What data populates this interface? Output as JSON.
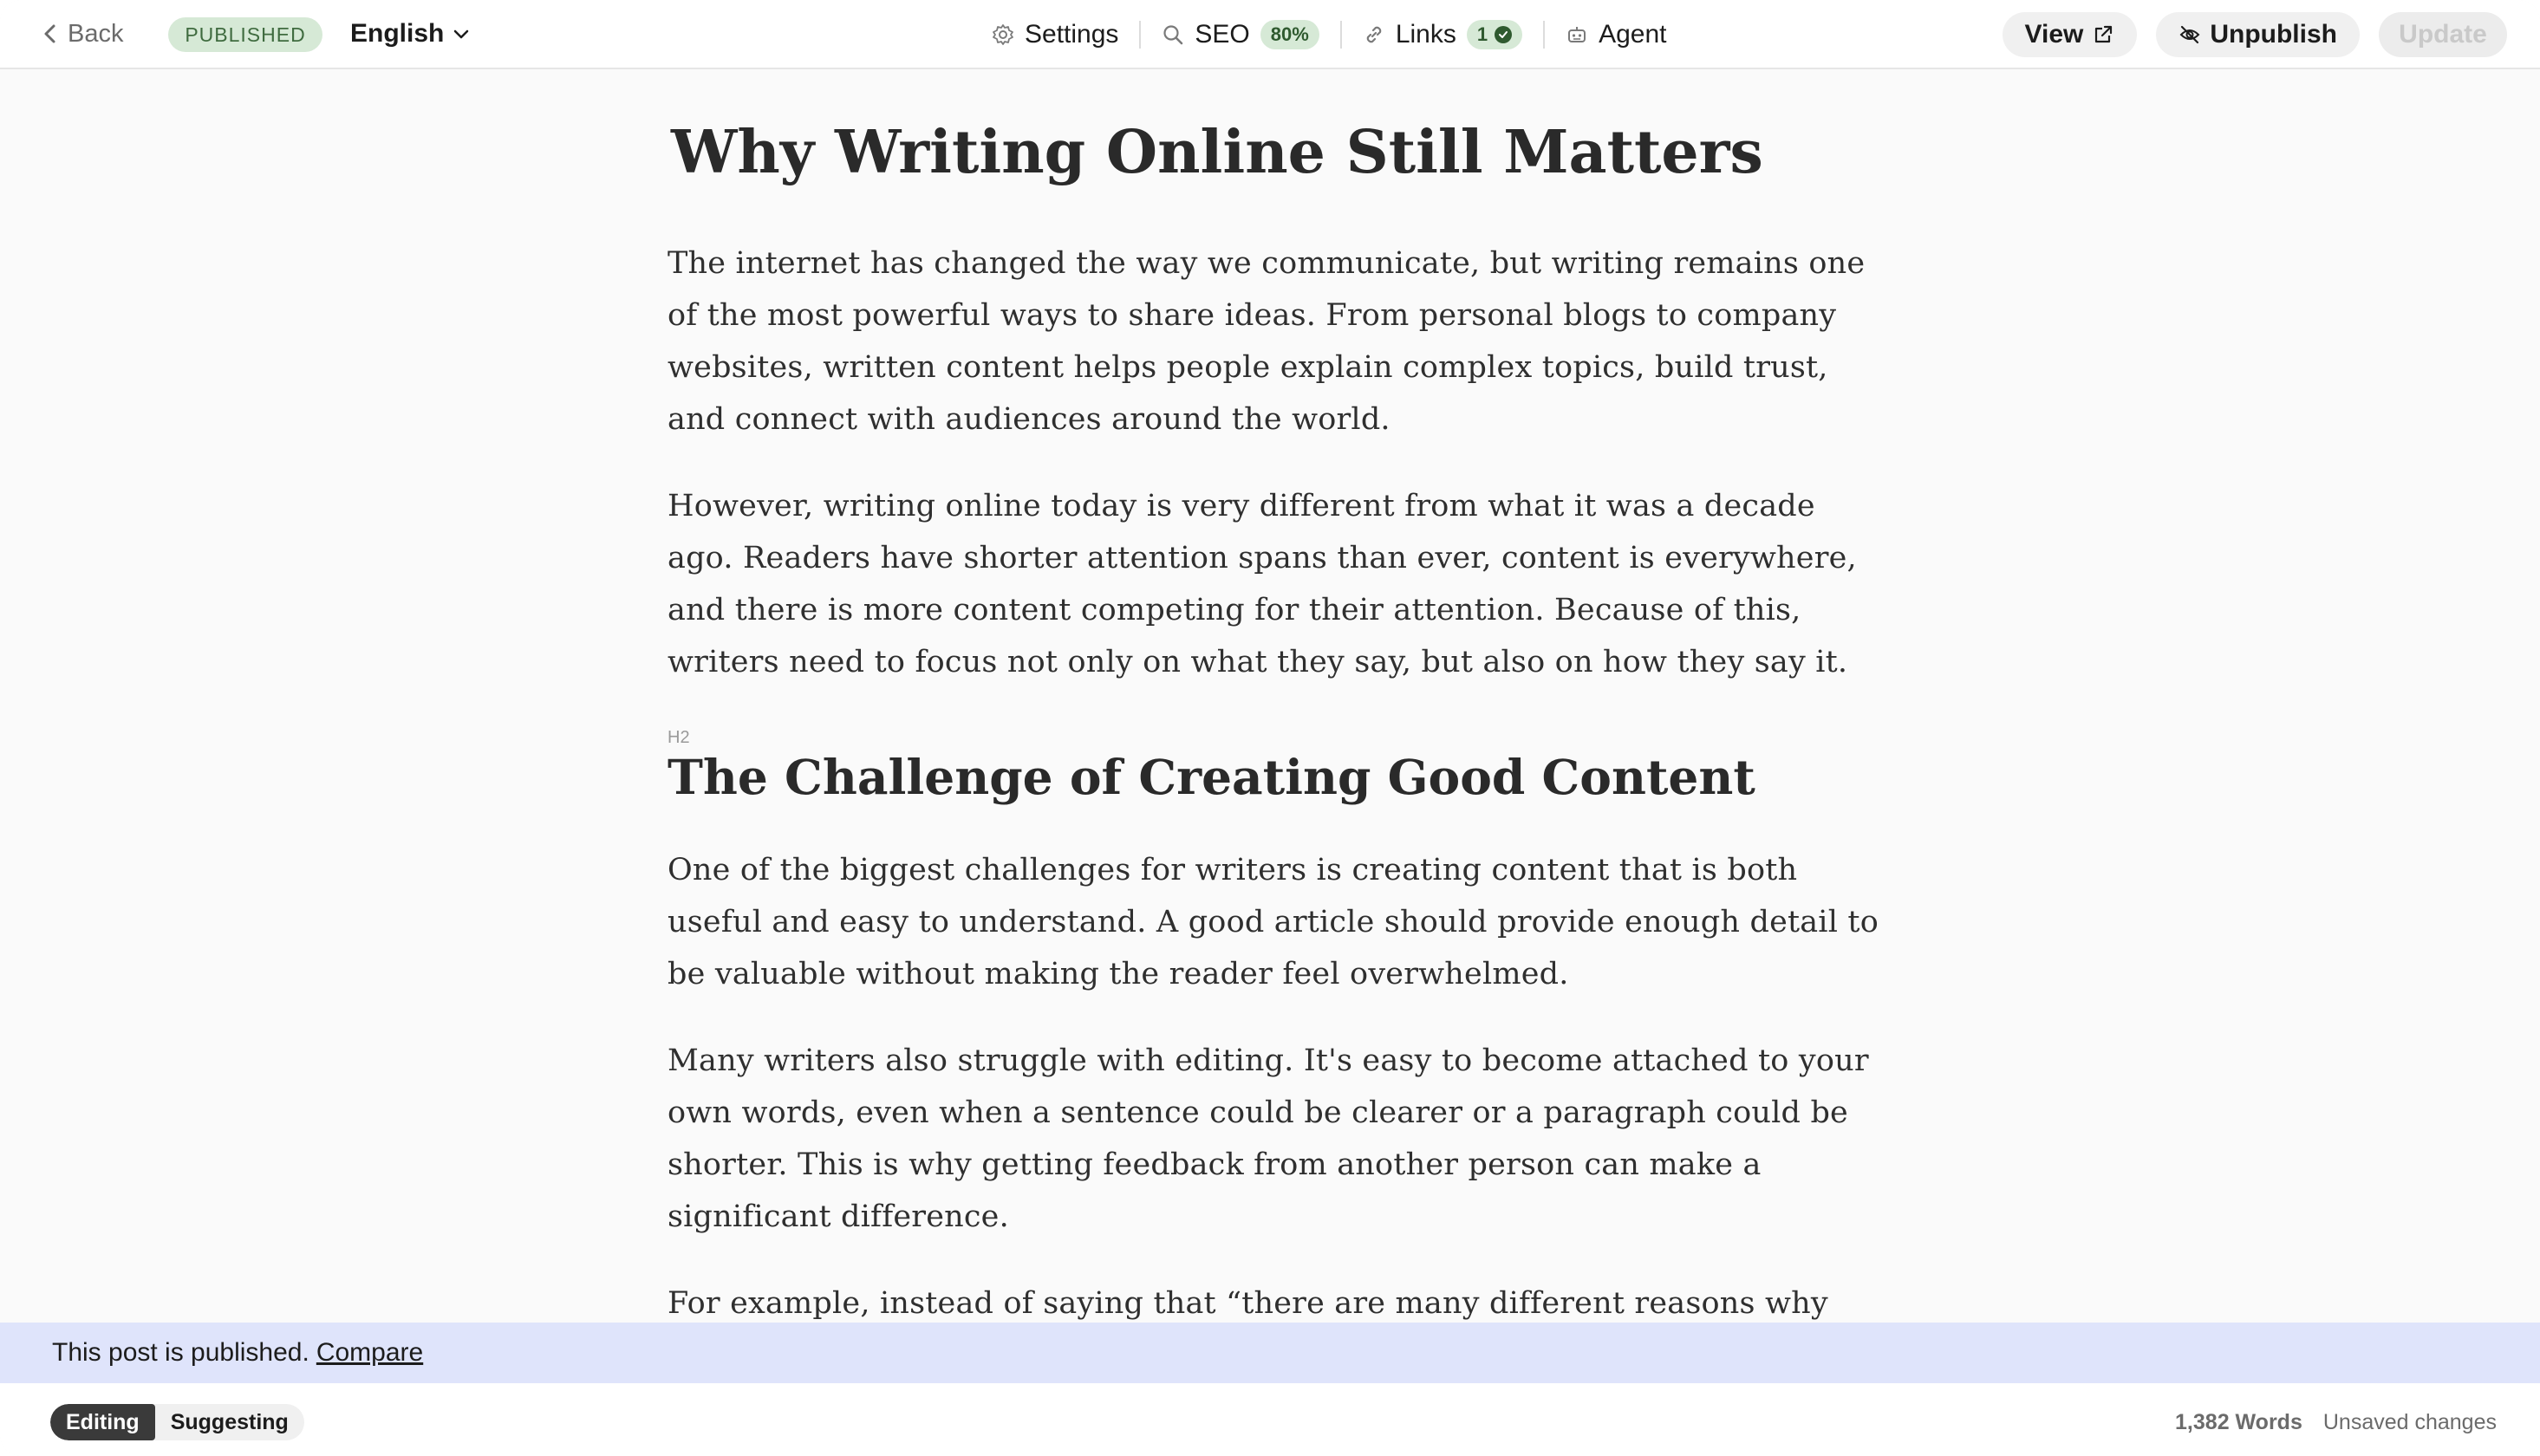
{
  "topbar": {
    "back_label": "Back",
    "status": "PUBLISHED",
    "language": "English",
    "nav": {
      "settings_label": "Settings",
      "seo_label": "SEO",
      "seo_score": "80%",
      "links_label": "Links",
      "links_count": "1",
      "agent_label": "Agent"
    },
    "view_label": "View",
    "unpublish_label": "Unpublish",
    "update_label": "Update"
  },
  "article": {
    "title": "Why Writing Online Still Matters",
    "paragraphs": [
      "The internet has changed the way we communicate, but writing remains one of the most powerful ways to share ideas. From personal blogs to company websites, written content helps people explain complex topics, build trust, and connect with audiences around the world.",
      "However, writing online today is very different from what it was a decade ago. Readers have shorter attention spans than ever, content is everywhere, and there is more content competing for their attention. Because of this, writers need to focus not only on what they say, but also on how they say it."
    ],
    "heading_tag": "H2",
    "heading": "The Challenge of Creating Good Content",
    "paragraphs2": [
      "One of the biggest challenges for writers is creating content that is both useful and easy to understand. A good article should provide enough detail to be valuable without making the reader feel overwhelmed.",
      "Many writers also struggle with editing. It's easy to become attached to your own words, even when a sentence could be clearer or a paragraph could be shorter. This is why getting feedback from another person can make a significant difference.",
      "For example, instead of saying that “there are many different reasons why"
    ]
  },
  "banner": {
    "text": "This post is published.",
    "link_label": "Compare"
  },
  "footer": {
    "mode_editing": "Editing",
    "mode_suggesting": "Suggesting",
    "word_count": "1,382 Words",
    "save_status": "Unsaved changes"
  },
  "colors": {
    "published_badge_bg": "#d6e9d6",
    "banner_bg": "#dfe4fb",
    "active_mode_bg": "#3a3a3a"
  }
}
